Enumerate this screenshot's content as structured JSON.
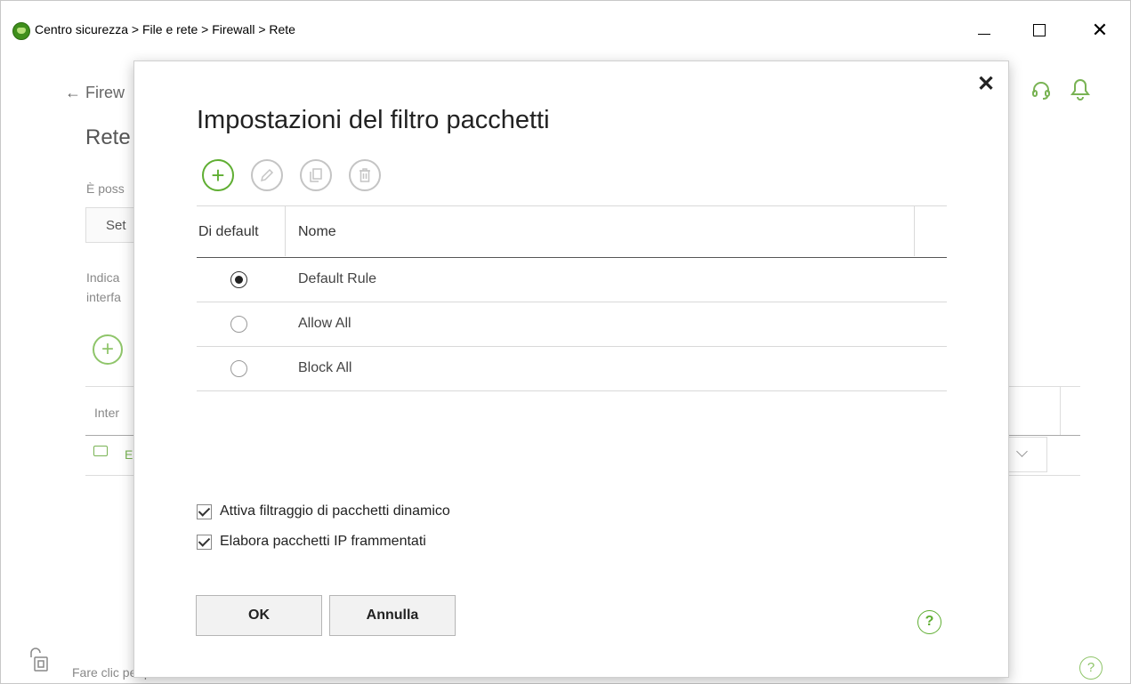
{
  "window": {
    "breadcrumb": "Centro sicurezza > File e rete > Firewall > Rete",
    "minimize_label": "—",
    "close_label": "✕"
  },
  "background": {
    "back_link": "← Firew",
    "title": "Rete",
    "description": "È poss",
    "select_label": "Set",
    "description2": "Indica interfa",
    "add_label": "+",
    "column_header": "Inter",
    "interface_label": "E",
    "lock_label": "Fare clic per proibire modifiche",
    "help_label": "?"
  },
  "dialog": {
    "close_label": "✕",
    "title": "Impostazioni del filtro pacchetti",
    "toolbar": {
      "add_label": "+"
    },
    "table": {
      "columns": [
        "Di default",
        "Nome"
      ],
      "rows": [
        {
          "name": "Default Rule",
          "selected": true
        },
        {
          "name": "Allow All",
          "selected": false
        },
        {
          "name": "Block All",
          "selected": false
        }
      ]
    },
    "options": [
      {
        "label": "Attiva filtraggio di pacchetti dinamico",
        "checked": true
      },
      {
        "label": "Elabora pacchetti IP frammentati",
        "checked": true
      }
    ],
    "ok_label": "OK",
    "cancel_label": "Annulla",
    "help_label": "?"
  },
  "colors": {
    "accent_green": "#5fae32",
    "disabled_gray": "#c4c4c4"
  }
}
